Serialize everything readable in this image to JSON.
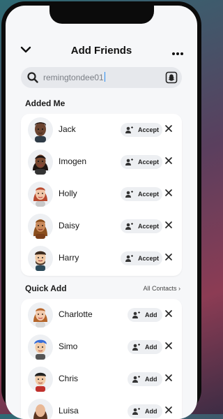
{
  "header": {
    "title": "Add Friends",
    "back_icon": "chevron-down-icon",
    "more_icon": "more-dots-icon"
  },
  "search": {
    "value": "remingtondee01",
    "icon": "search-icon",
    "right_icon": "snap-profile-icon"
  },
  "added_me": {
    "title": "Added Me",
    "accept_label": "Accept",
    "items": [
      {
        "name": "Jack"
      },
      {
        "name": "Imogen"
      },
      {
        "name": "Holly"
      },
      {
        "name": "Daisy"
      },
      {
        "name": "Harry"
      }
    ]
  },
  "quick_add": {
    "title": "Quick Add",
    "link": "All Contacts",
    "add_label": "Add",
    "items": [
      {
        "name": "Charlotte"
      },
      {
        "name": "Simo"
      },
      {
        "name": "Chris"
      },
      {
        "name": "Luisa"
      }
    ]
  },
  "colors": {
    "background": "#f6f7f9",
    "card": "#ffffff",
    "button": "#edeff2",
    "caret": "#2a8cf0"
  }
}
